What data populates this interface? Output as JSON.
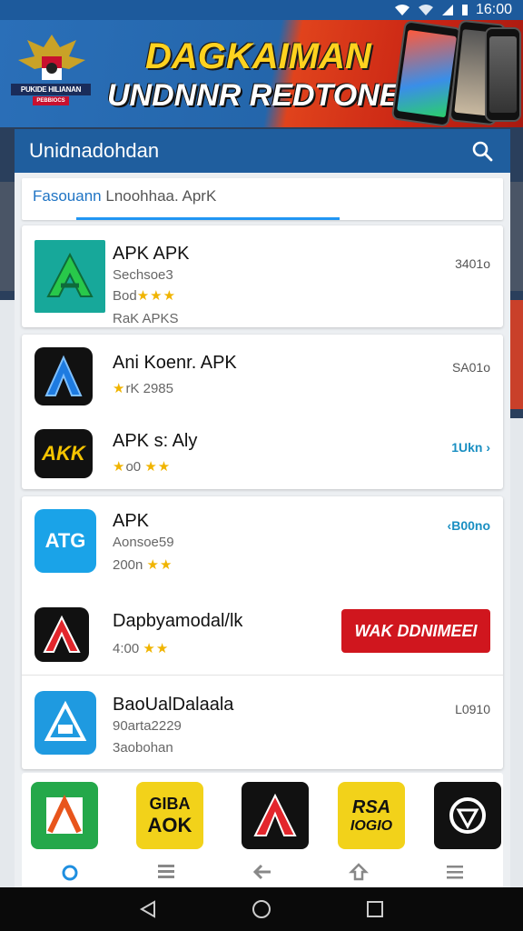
{
  "status_bar": {
    "time": "16:00"
  },
  "banner": {
    "title_line1": "DAGKAIMAN",
    "title_line2": "UNDNNR REDTONESIA!",
    "emblem_text": "PUKIDE HILIANAN",
    "emblem_subtext": "PEBBIOCS"
  },
  "app_bar": {
    "title": "Unidnadohdan"
  },
  "tabs": {
    "active": "Fasouann",
    "rest": "Lnoohhaa. AprK"
  },
  "list": [
    {
      "name": "APK APK",
      "sub1": "Sechsoe3",
      "sub2": "Bod",
      "sub3": "RaK APKS",
      "size": "3401o"
    },
    {
      "name": "Ani Koenr. APK",
      "sub1": "rK 2985",
      "size": "SA01o"
    },
    {
      "name": "APK s: Aly",
      "sub1": "o0",
      "size": "1Ukn"
    },
    {
      "name": "APK",
      "sub1": "Aonsoe59",
      "sub2": "200n",
      "size": "B00no"
    },
    {
      "name": "Dapbyamodal/lk",
      "sub1": "4:00",
      "button": "WAK DDNIMEEI"
    },
    {
      "name": "BaoUalDalaala",
      "sub1": "90arta2229",
      "sub2": "3aobohan",
      "size": "L0910"
    }
  ],
  "star_glyph": "★★★",
  "star_glyph_2": "★★",
  "icon_texts": {
    "akk": "AKK",
    "atg": "ATG",
    "strip_2a": "GIBA",
    "strip_2b": "AOK",
    "strip_4a": "RSA",
    "strip_4b": "IOGIO"
  },
  "icons": [
    "search-icon",
    "home-icon",
    "list-icon",
    "back-arrow-icon",
    "upload-icon",
    "menu-icon"
  ],
  "colors": {
    "primary": "#1f5e9e",
    "accent": "#2196f3",
    "danger": "#d0161e",
    "star": "#f0b400"
  }
}
